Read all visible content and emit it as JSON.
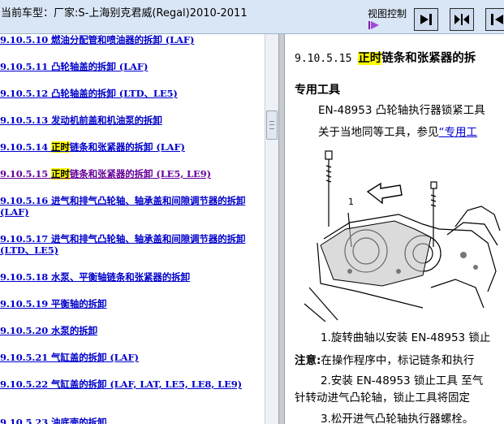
{
  "header": {
    "car_model": "当前车型：厂家:S-上海别克君威(Regal)2010-2011",
    "view_control": "视图控制"
  },
  "toc": [
    {
      "text": "9.10.5.10 燃油分配管和喷油器的拆卸 (LAF)"
    },
    {
      "text": "9.10.5.11 凸轮轴盖的拆卸 (LAF)"
    },
    {
      "text": "9.10.5.12 凸轮轴盖的拆卸 (LTD、LE5)"
    },
    {
      "text": "9.10.5.13 发动机前盖和机油泵的拆卸"
    },
    {
      "num": "9.10.5.14 ",
      "hl": "正时",
      "rest": "链条和张紧器的拆卸 (LAF)"
    },
    {
      "num": "9.10.5.15 ",
      "hl": "正时",
      "rest": "链条和张紧器的拆卸 (LE5, LE9)"
    },
    {
      "text": "9.10.5.16 进气和排气凸轮轴、轴承盖和间隙调节器的拆卸 (LAF)"
    },
    {
      "text": "9.10.5.17 进气和排气凸轮轴、轴承盖和间隙调节器的拆卸 (LTD、LE5)"
    },
    {
      "text": "9.10.5.18 水泵、平衡轴链条和张紧器的拆卸"
    },
    {
      "text": "9.10.5.19 平衡轴的拆卸"
    },
    {
      "text": "9.10.5.20 水泵的拆卸"
    },
    {
      "text": "9.10.5.21 气缸盖的拆卸 (LAF)"
    },
    {
      "text": "9.10.5.22 气缸盖的拆卸 (LAF, LAT, LE5, LE8, LE9)"
    },
    {
      "text": "9.10.5.23 油底壳的拆卸"
    }
  ],
  "doc": {
    "title_num": "9.10.5.15 ",
    "title_hl": "正时",
    "title_rest": "链条和张紧器的拆",
    "special_tools": "专用工具",
    "tool_line": "EN-48953 凸轮轴执行器锁紧工具",
    "equiv_prefix": "关于当地同等工具，参见",
    "equiv_link": "“专用工",
    "figure_label": "1",
    "step1": "1.旋转曲轴以安装 EN-48953 锁止",
    "note_label": "注意:",
    "note_text": "在操作程序中，标记链条和执行",
    "step2": "2.安装 EN-48953 锁止工具 至气",
    "step2b": "针转动进气凸轮轴，锁止工具将固定",
    "step3": "3.松开进气凸轮轴执行器螺栓。"
  },
  "colors": {
    "toolbar": "#d9e6f6",
    "link": "#0000cc",
    "visited": "#660099",
    "highlight": "#ffff00"
  }
}
